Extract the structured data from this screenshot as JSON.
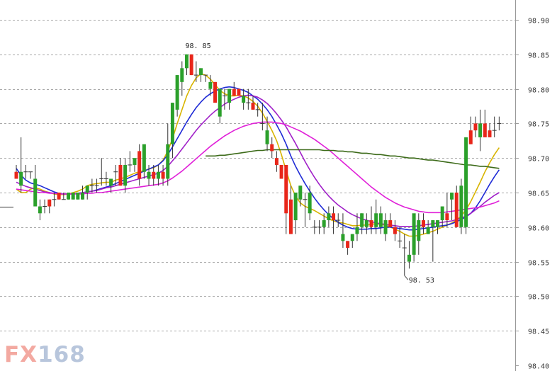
{
  "chart_data": {
    "type": "candlestick",
    "ylim": [
      98.4,
      98.93
    ],
    "y_ticks": [
      "98.90",
      "98.85",
      "98.80",
      "98.75",
      "98.70",
      "98.65",
      "98.60",
      "98.55",
      "98.50",
      "98.45",
      "98.40"
    ],
    "grid": true,
    "y_axis_side": "right",
    "colors": {
      "up": "#2ba02b",
      "down": "#e8261a",
      "wick": "#333333"
    },
    "candles": [
      [
        98.68,
        98.69,
        98.67,
        98.67
      ],
      [
        98.66,
        98.73,
        98.65,
        98.68
      ],
      [
        98.68,
        98.69,
        98.67,
        98.68
      ],
      [
        98.68,
        98.68,
        98.67,
        98.68
      ],
      [
        98.63,
        98.69,
        98.63,
        98.67
      ],
      [
        98.62,
        98.64,
        98.61,
        98.63
      ],
      [
        98.63,
        98.64,
        98.62,
        98.63
      ],
      [
        98.64,
        98.64,
        98.62,
        98.63
      ],
      [
        98.64,
        98.65,
        98.63,
        98.64
      ],
      [
        98.65,
        98.65,
        98.64,
        98.64
      ],
      [
        98.64,
        98.65,
        98.64,
        98.64
      ],
      [
        98.64,
        98.65,
        98.64,
        98.65
      ],
      [
        98.64,
        98.65,
        98.64,
        98.65
      ],
      [
        98.64,
        98.65,
        98.64,
        98.65
      ],
      [
        98.64,
        98.66,
        98.64,
        98.65
      ],
      [
        98.65,
        98.66,
        98.64,
        98.66
      ],
      [
        98.66,
        98.67,
        98.65,
        98.66
      ],
      [
        98.66,
        98.67,
        98.65,
        98.66
      ],
      [
        98.67,
        98.7,
        98.66,
        98.67
      ],
      [
        98.67,
        98.68,
        98.66,
        98.67
      ],
      [
        98.66,
        98.67,
        98.65,
        98.67
      ],
      [
        98.68,
        98.69,
        98.66,
        98.68
      ],
      [
        98.69,
        98.7,
        98.66,
        98.66
      ],
      [
        98.66,
        98.7,
        98.65,
        98.69
      ],
      [
        98.69,
        98.71,
        98.68,
        98.69
      ],
      [
        98.69,
        98.7,
        98.68,
        98.7
      ],
      [
        98.71,
        98.72,
        98.66,
        98.67
      ],
      [
        98.68,
        98.71,
        98.67,
        98.72
      ],
      [
        98.67,
        98.69,
        98.66,
        98.68
      ],
      [
        98.68,
        98.69,
        98.66,
        98.67
      ],
      [
        98.67,
        98.69,
        98.66,
        98.68
      ],
      [
        98.68,
        98.69,
        98.66,
        98.67
      ],
      [
        98.67,
        98.75,
        98.66,
        98.72
      ],
      [
        98.72,
        98.78,
        98.7,
        98.78
      ],
      [
        98.77,
        98.82,
        98.76,
        98.82
      ],
      [
        98.81,
        98.84,
        98.79,
        98.83
      ],
      [
        98.83,
        98.85,
        98.82,
        98.85
      ],
      [
        98.85,
        98.85,
        98.82,
        98.82
      ],
      [
        98.82,
        98.84,
        98.81,
        98.82
      ],
      [
        98.82,
        98.83,
        98.81,
        98.83
      ],
      [
        98.82,
        98.82,
        98.81,
        98.82
      ],
      [
        98.8,
        98.82,
        98.79,
        98.81
      ],
      [
        98.81,
        98.81,
        98.78,
        98.78
      ],
      [
        98.76,
        98.8,
        98.75,
        98.8
      ],
      [
        98.79,
        98.8,
        98.77,
        98.79
      ],
      [
        98.78,
        98.8,
        98.77,
        98.8
      ],
      [
        98.8,
        98.81,
        98.79,
        98.79
      ],
      [
        98.8,
        98.8,
        98.79,
        98.79
      ],
      [
        98.78,
        98.8,
        98.77,
        98.79
      ],
      [
        98.78,
        98.8,
        98.77,
        98.78
      ],
      [
        98.78,
        98.79,
        98.77,
        98.77
      ],
      [
        98.77,
        98.78,
        98.76,
        98.77
      ],
      [
        98.75,
        98.78,
        98.74,
        98.75
      ],
      [
        98.72,
        98.76,
        98.71,
        98.74
      ],
      [
        98.72,
        98.73,
        98.7,
        98.71
      ],
      [
        98.7,
        98.71,
        98.68,
        98.69
      ],
      [
        98.69,
        98.69,
        98.67,
        98.67
      ],
      [
        98.69,
        98.69,
        98.59,
        98.62
      ],
      [
        98.64,
        98.66,
        98.59,
        98.59
      ],
      [
        98.61,
        98.65,
        98.59,
        98.65
      ],
      [
        98.64,
        98.66,
        98.63,
        98.66
      ],
      [
        98.64,
        98.65,
        98.6,
        98.64
      ],
      [
        98.62,
        98.66,
        98.61,
        98.65
      ],
      [
        98.6,
        98.61,
        98.59,
        98.6
      ],
      [
        98.6,
        98.61,
        98.59,
        98.6
      ],
      [
        98.6,
        98.62,
        98.59,
        98.61
      ],
      [
        98.61,
        98.63,
        98.6,
        98.62
      ],
      [
        98.62,
        98.63,
        98.59,
        98.61
      ],
      [
        98.61,
        98.62,
        98.6,
        98.61
      ],
      [
        98.58,
        98.62,
        98.57,
        98.59
      ],
      [
        98.58,
        98.58,
        98.56,
        98.57
      ],
      [
        98.58,
        98.59,
        98.57,
        98.59
      ],
      [
        98.59,
        98.62,
        98.58,
        98.6
      ],
      [
        98.6,
        98.62,
        98.59,
        98.62
      ],
      [
        98.6,
        98.62,
        98.59,
        98.61
      ],
      [
        98.61,
        98.63,
        98.59,
        98.6
      ],
      [
        98.6,
        98.64,
        98.59,
        98.62
      ],
      [
        98.6,
        98.63,
        98.59,
        98.62
      ],
      [
        98.59,
        98.62,
        98.58,
        98.61
      ],
      [
        98.61,
        98.62,
        98.6,
        98.6
      ],
      [
        98.6,
        98.61,
        98.58,
        98.59
      ],
      [
        98.58,
        98.6,
        98.57,
        98.58
      ],
      [
        98.57,
        98.59,
        98.53,
        98.57
      ],
      [
        98.55,
        98.58,
        98.54,
        98.56
      ],
      [
        98.56,
        98.61,
        98.55,
        98.62
      ],
      [
        98.58,
        98.62,
        98.56,
        98.61
      ],
      [
        98.61,
        98.62,
        98.59,
        98.6
      ],
      [
        98.59,
        98.61,
        98.59,
        98.6
      ],
      [
        98.6,
        98.61,
        98.55,
        98.61
      ],
      [
        98.6,
        98.61,
        98.59,
        98.61
      ],
      [
        98.61,
        98.63,
        98.6,
        98.63
      ],
      [
        98.62,
        98.65,
        98.6,
        98.61
      ],
      [
        98.64,
        98.65,
        98.61,
        98.65
      ],
      [
        98.65,
        98.66,
        98.6,
        98.6
      ],
      [
        98.6,
        98.67,
        98.59,
        98.66
      ],
      [
        98.6,
        98.73,
        98.59,
        98.73
      ],
      [
        98.74,
        98.76,
        98.72,
        98.72
      ],
      [
        98.75,
        98.76,
        98.73,
        98.74
      ],
      [
        98.73,
        98.77,
        98.71,
        98.75
      ],
      [
        98.75,
        98.77,
        98.73,
        98.73
      ],
      [
        98.74,
        98.75,
        98.73,
        98.73
      ],
      [
        98.74,
        98.76,
        98.73,
        98.74
      ],
      [
        98.75,
        98.76,
        98.74,
        98.75
      ]
    ],
    "series": [
      {
        "color": "#d8b400",
        "values": [
          98.655,
          98.65,
          98.65,
          98.655,
          98.657,
          98.655,
          98.652,
          98.65,
          98.648,
          98.647,
          98.647,
          98.648,
          98.65,
          98.652,
          98.655,
          98.66,
          98.662,
          98.663,
          98.664,
          98.665,
          98.665,
          98.668,
          98.67,
          98.672,
          98.675,
          98.678,
          98.68,
          98.682,
          98.684,
          98.686,
          98.69,
          98.697,
          98.71,
          98.728,
          98.75,
          98.77,
          98.79,
          98.805,
          98.816,
          98.822,
          98.82,
          98.814,
          98.806,
          98.798,
          98.793,
          98.79,
          98.79,
          98.791,
          98.79,
          98.787,
          98.782,
          98.775,
          98.765,
          98.753,
          98.74,
          98.725,
          98.705,
          98.682,
          98.66,
          98.645,
          98.635,
          98.63,
          98.627,
          98.624,
          98.62,
          98.616,
          98.612,
          98.609,
          98.607,
          98.606,
          98.604,
          98.602,
          98.602,
          98.603,
          98.603,
          98.604,
          98.605,
          98.604,
          98.603,
          98.6,
          98.597,
          98.594,
          98.59,
          98.587,
          98.587,
          98.588,
          98.59,
          98.592,
          98.594,
          98.597,
          98.6,
          98.603,
          98.606,
          98.61,
          98.616,
          98.625,
          98.637,
          98.651,
          98.665,
          98.68,
          98.693,
          98.705,
          98.715
        ]
      },
      {
        "color": "#1f2bd6",
        "values": [
          98.685,
          98.675,
          98.668,
          98.664,
          98.662,
          98.66,
          98.657,
          98.654,
          98.651,
          98.649,
          98.648,
          98.648,
          98.648,
          98.649,
          98.65,
          98.651,
          98.652,
          98.654,
          98.656,
          98.658,
          98.66,
          98.663,
          98.666,
          98.669,
          98.672,
          98.675,
          98.678,
          98.681,
          98.684,
          98.687,
          98.69,
          98.696,
          98.705,
          98.716,
          98.728,
          98.74,
          98.752,
          98.763,
          98.773,
          98.781,
          98.788,
          98.793,
          98.797,
          98.8,
          98.802,
          98.803,
          98.802,
          98.8,
          98.798,
          98.795,
          98.79,
          98.785,
          98.778,
          98.77,
          98.76,
          98.748,
          98.735,
          98.72,
          98.703,
          98.688,
          98.675,
          98.663,
          98.652,
          98.642,
          98.633,
          98.625,
          98.618,
          98.612,
          98.607,
          98.603,
          98.6,
          98.598,
          98.597,
          98.597,
          98.597,
          98.598,
          98.598,
          98.599,
          98.6,
          98.6,
          98.599,
          98.598,
          98.597,
          98.596,
          98.596,
          98.597,
          98.598,
          98.599,
          98.6,
          98.601,
          98.602,
          98.603,
          98.605,
          98.608,
          98.611,
          98.615,
          98.62,
          98.628,
          98.638,
          98.65,
          98.662,
          98.673,
          98.683
        ]
      },
      {
        "color": "#a020c8",
        "values": [
          98.665,
          98.662,
          98.659,
          98.657,
          98.655,
          98.653,
          98.651,
          98.65,
          98.649,
          98.648,
          98.648,
          98.648,
          98.648,
          98.649,
          98.65,
          98.651,
          98.652,
          98.653,
          98.655,
          98.657,
          98.658,
          98.66,
          98.662,
          98.664,
          98.666,
          98.668,
          98.67,
          98.672,
          98.674,
          98.676,
          98.678,
          98.682,
          98.688,
          98.696,
          98.704,
          98.713,
          98.722,
          98.731,
          98.74,
          98.748,
          98.755,
          98.762,
          98.768,
          98.773,
          98.778,
          98.782,
          98.785,
          98.788,
          98.79,
          98.791,
          98.79,
          98.788,
          98.784,
          98.779,
          98.772,
          98.764,
          98.755,
          98.745,
          98.733,
          98.721,
          98.708,
          98.695,
          98.683,
          98.672,
          98.662,
          98.653,
          98.645,
          98.638,
          98.632,
          98.627,
          98.622,
          98.618,
          98.615,
          98.612,
          98.61,
          98.608,
          98.606,
          98.605,
          98.604,
          98.603,
          98.602,
          98.601,
          98.601,
          98.601,
          98.601,
          98.602,
          98.603,
          98.604,
          98.605,
          98.606,
          98.607,
          98.608,
          98.609,
          98.611,
          98.613,
          98.616,
          98.62,
          98.625,
          98.63,
          98.636,
          98.641,
          98.646,
          98.65
        ]
      },
      {
        "color": "#e020d8",
        "values": [
          98.655,
          98.654,
          98.653,
          98.652,
          98.651,
          98.65,
          98.65,
          98.649,
          98.649,
          98.648,
          98.648,
          98.648,
          98.648,
          98.648,
          98.648,
          98.649,
          98.649,
          98.65,
          98.65,
          98.651,
          98.652,
          98.653,
          98.654,
          98.655,
          98.656,
          98.657,
          98.658,
          98.659,
          98.66,
          98.661,
          98.662,
          98.664,
          98.667,
          98.671,
          98.676,
          98.681,
          98.687,
          98.693,
          98.699,
          98.705,
          98.711,
          98.717,
          98.722,
          98.727,
          98.732,
          98.736,
          98.74,
          98.743,
          98.746,
          98.748,
          98.75,
          98.751,
          98.752,
          98.752,
          98.752,
          98.751,
          98.75,
          98.748,
          98.745,
          98.742,
          98.739,
          98.735,
          98.731,
          98.727,
          98.722,
          98.717,
          98.712,
          98.706,
          98.7,
          98.694,
          98.688,
          98.682,
          98.676,
          98.67,
          98.664,
          98.658,
          98.653,
          98.648,
          98.643,
          98.639,
          98.635,
          98.632,
          98.629,
          98.627,
          98.625,
          98.623,
          98.622,
          98.621,
          98.621,
          98.621,
          98.621,
          98.622,
          98.623,
          98.624,
          98.625,
          98.626,
          98.627,
          98.628,
          98.629,
          98.631,
          98.633,
          98.635,
          98.638
        ]
      },
      {
        "color": "#3d6b1a",
        "start": 40,
        "values": [
          98.703,
          98.703,
          98.703,
          98.704,
          98.704,
          98.705,
          98.706,
          98.707,
          98.708,
          98.709,
          98.71,
          98.711,
          98.711,
          98.712,
          98.712,
          98.712,
          98.712,
          98.712,
          98.712,
          98.712,
          98.712,
          98.712,
          98.712,
          98.712,
          98.712,
          98.711,
          98.711,
          98.711,
          98.71,
          98.71,
          98.709,
          98.709,
          98.708,
          98.707,
          98.707,
          98.706,
          98.705,
          98.705,
          98.704,
          98.703,
          98.703,
          98.702,
          98.701,
          98.7,
          98.7,
          98.699,
          98.698,
          98.697,
          98.697,
          98.696,
          98.695,
          98.694,
          98.693,
          98.692,
          98.691,
          98.69,
          98.69,
          98.689,
          98.688,
          98.688,
          98.687,
          98.686,
          98.685
        ]
      }
    ],
    "annotations": [
      {
        "label": "98. 85",
        "index": 36,
        "value": 98.85,
        "position": "above"
      },
      {
        "label": "98. 53",
        "index": 82,
        "value": 98.53,
        "position": "below"
      }
    ],
    "stub_line_value": 98.63
  },
  "logo": {
    "fx": "FX",
    "num": "168"
  }
}
